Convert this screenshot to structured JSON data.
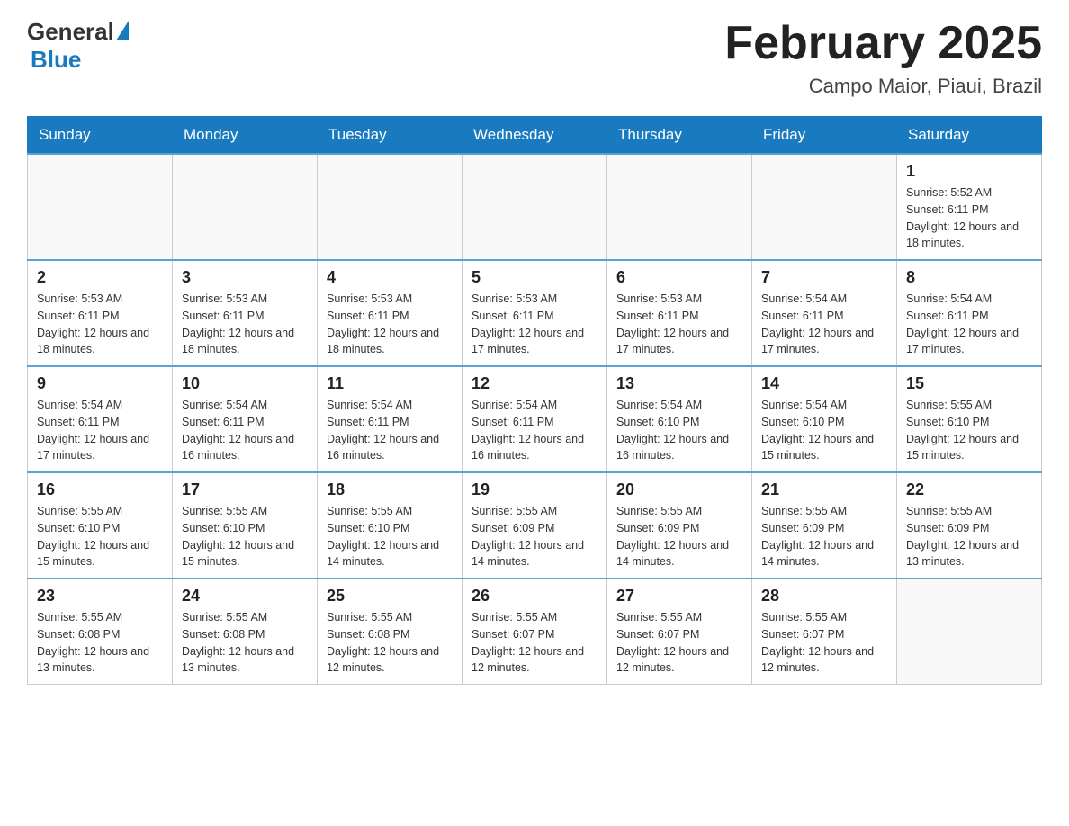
{
  "header": {
    "logo_general": "General",
    "logo_blue": "Blue",
    "month_title": "February 2025",
    "location": "Campo Maior, Piaui, Brazil"
  },
  "days_of_week": [
    "Sunday",
    "Monday",
    "Tuesday",
    "Wednesday",
    "Thursday",
    "Friday",
    "Saturday"
  ],
  "weeks": [
    [
      {
        "day": "",
        "info": ""
      },
      {
        "day": "",
        "info": ""
      },
      {
        "day": "",
        "info": ""
      },
      {
        "day": "",
        "info": ""
      },
      {
        "day": "",
        "info": ""
      },
      {
        "day": "",
        "info": ""
      },
      {
        "day": "1",
        "info": "Sunrise: 5:52 AM\nSunset: 6:11 PM\nDaylight: 12 hours and 18 minutes."
      }
    ],
    [
      {
        "day": "2",
        "info": "Sunrise: 5:53 AM\nSunset: 6:11 PM\nDaylight: 12 hours and 18 minutes."
      },
      {
        "day": "3",
        "info": "Sunrise: 5:53 AM\nSunset: 6:11 PM\nDaylight: 12 hours and 18 minutes."
      },
      {
        "day": "4",
        "info": "Sunrise: 5:53 AM\nSunset: 6:11 PM\nDaylight: 12 hours and 18 minutes."
      },
      {
        "day": "5",
        "info": "Sunrise: 5:53 AM\nSunset: 6:11 PM\nDaylight: 12 hours and 17 minutes."
      },
      {
        "day": "6",
        "info": "Sunrise: 5:53 AM\nSunset: 6:11 PM\nDaylight: 12 hours and 17 minutes."
      },
      {
        "day": "7",
        "info": "Sunrise: 5:54 AM\nSunset: 6:11 PM\nDaylight: 12 hours and 17 minutes."
      },
      {
        "day": "8",
        "info": "Sunrise: 5:54 AM\nSunset: 6:11 PM\nDaylight: 12 hours and 17 minutes."
      }
    ],
    [
      {
        "day": "9",
        "info": "Sunrise: 5:54 AM\nSunset: 6:11 PM\nDaylight: 12 hours and 17 minutes."
      },
      {
        "day": "10",
        "info": "Sunrise: 5:54 AM\nSunset: 6:11 PM\nDaylight: 12 hours and 16 minutes."
      },
      {
        "day": "11",
        "info": "Sunrise: 5:54 AM\nSunset: 6:11 PM\nDaylight: 12 hours and 16 minutes."
      },
      {
        "day": "12",
        "info": "Sunrise: 5:54 AM\nSunset: 6:11 PM\nDaylight: 12 hours and 16 minutes."
      },
      {
        "day": "13",
        "info": "Sunrise: 5:54 AM\nSunset: 6:10 PM\nDaylight: 12 hours and 16 minutes."
      },
      {
        "day": "14",
        "info": "Sunrise: 5:54 AM\nSunset: 6:10 PM\nDaylight: 12 hours and 15 minutes."
      },
      {
        "day": "15",
        "info": "Sunrise: 5:55 AM\nSunset: 6:10 PM\nDaylight: 12 hours and 15 minutes."
      }
    ],
    [
      {
        "day": "16",
        "info": "Sunrise: 5:55 AM\nSunset: 6:10 PM\nDaylight: 12 hours and 15 minutes."
      },
      {
        "day": "17",
        "info": "Sunrise: 5:55 AM\nSunset: 6:10 PM\nDaylight: 12 hours and 15 minutes."
      },
      {
        "day": "18",
        "info": "Sunrise: 5:55 AM\nSunset: 6:10 PM\nDaylight: 12 hours and 14 minutes."
      },
      {
        "day": "19",
        "info": "Sunrise: 5:55 AM\nSunset: 6:09 PM\nDaylight: 12 hours and 14 minutes."
      },
      {
        "day": "20",
        "info": "Sunrise: 5:55 AM\nSunset: 6:09 PM\nDaylight: 12 hours and 14 minutes."
      },
      {
        "day": "21",
        "info": "Sunrise: 5:55 AM\nSunset: 6:09 PM\nDaylight: 12 hours and 14 minutes."
      },
      {
        "day": "22",
        "info": "Sunrise: 5:55 AM\nSunset: 6:09 PM\nDaylight: 12 hours and 13 minutes."
      }
    ],
    [
      {
        "day": "23",
        "info": "Sunrise: 5:55 AM\nSunset: 6:08 PM\nDaylight: 12 hours and 13 minutes."
      },
      {
        "day": "24",
        "info": "Sunrise: 5:55 AM\nSunset: 6:08 PM\nDaylight: 12 hours and 13 minutes."
      },
      {
        "day": "25",
        "info": "Sunrise: 5:55 AM\nSunset: 6:08 PM\nDaylight: 12 hours and 12 minutes."
      },
      {
        "day": "26",
        "info": "Sunrise: 5:55 AM\nSunset: 6:07 PM\nDaylight: 12 hours and 12 minutes."
      },
      {
        "day": "27",
        "info": "Sunrise: 5:55 AM\nSunset: 6:07 PM\nDaylight: 12 hours and 12 minutes."
      },
      {
        "day": "28",
        "info": "Sunrise: 5:55 AM\nSunset: 6:07 PM\nDaylight: 12 hours and 12 minutes."
      },
      {
        "day": "",
        "info": ""
      }
    ]
  ]
}
